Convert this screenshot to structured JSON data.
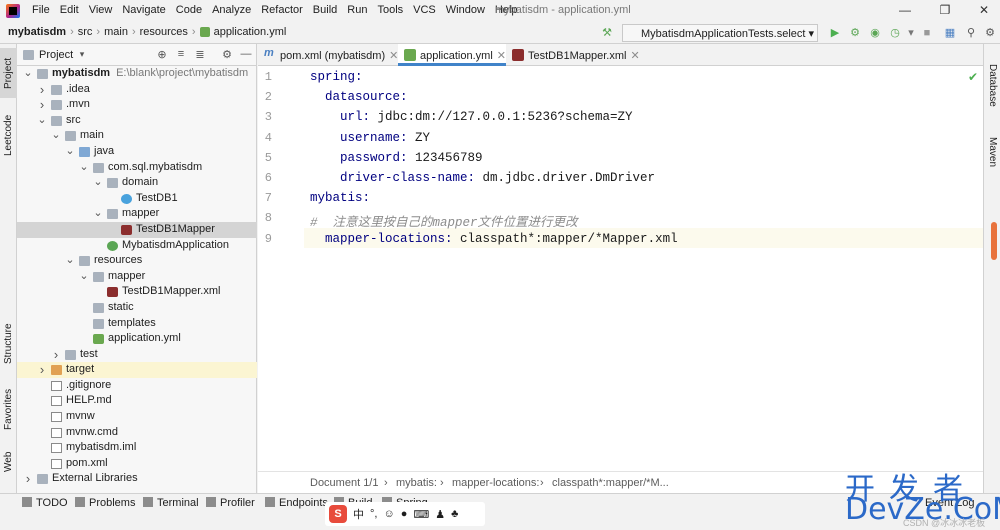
{
  "app": {
    "menus": [
      "File",
      "Edit",
      "View",
      "Navigate",
      "Code",
      "Analyze",
      "Refactor",
      "Build",
      "Run",
      "Tools",
      "VCS",
      "Window",
      "Help"
    ],
    "window_title": "mybatisdm - application.yml"
  },
  "breadcrumb": [
    "mybatisdm",
    "src",
    "main",
    "resources",
    "application.yml"
  ],
  "run_config": "MybatisdmApplicationTests.select",
  "left_tabs": [
    "Project",
    "Leetcode",
    "Structure",
    "Favorites",
    "Web"
  ],
  "right_tabs": [
    "Database",
    "Maven"
  ],
  "project_panel": {
    "title": "Project"
  },
  "tree": [
    {
      "label": "mybatisdm",
      "path": "E:\\blank\\project\\mybatisdm",
      "depth": 0,
      "arrow": "v",
      "icon": "folder"
    },
    {
      "label": ".idea",
      "depth": 1,
      "arrow": ">",
      "icon": "folder"
    },
    {
      "label": ".mvn",
      "depth": 1,
      "arrow": ">",
      "icon": "folder"
    },
    {
      "label": "src",
      "depth": 1,
      "arrow": "v",
      "icon": "folder"
    },
    {
      "label": "main",
      "depth": 2,
      "arrow": "v",
      "icon": "folder"
    },
    {
      "label": "java",
      "depth": 3,
      "arrow": "v",
      "icon": "folder-blue"
    },
    {
      "label": "com.sql.mybatisdm",
      "depth": 4,
      "arrow": "v",
      "icon": "folder"
    },
    {
      "label": "domain",
      "depth": 5,
      "arrow": "v",
      "icon": "folder"
    },
    {
      "label": "TestDB1",
      "depth": 6,
      "arrow": "",
      "icon": "class"
    },
    {
      "label": "mapper",
      "depth": 5,
      "arrow": "v",
      "icon": "folder"
    },
    {
      "label": "TestDB1Mapper",
      "depth": 6,
      "arrow": "",
      "icon": "xml",
      "selected": true
    },
    {
      "label": "MybatisdmApplication",
      "depth": 5,
      "arrow": "",
      "icon": "app"
    },
    {
      "label": "resources",
      "depth": 3,
      "arrow": "v",
      "icon": "folder"
    },
    {
      "label": "mapper",
      "depth": 4,
      "arrow": "v",
      "icon": "folder"
    },
    {
      "label": "TestDB1Mapper.xml",
      "depth": 5,
      "arrow": "",
      "icon": "xml"
    },
    {
      "label": "static",
      "depth": 4,
      "arrow": "",
      "icon": "folder"
    },
    {
      "label": "templates",
      "depth": 4,
      "arrow": "",
      "icon": "folder"
    },
    {
      "label": "application.yml",
      "depth": 4,
      "arrow": "",
      "icon": "yml"
    },
    {
      "label": "test",
      "depth": 2,
      "arrow": ">",
      "icon": "folder"
    },
    {
      "label": "target",
      "depth": 1,
      "arrow": ">",
      "icon": "folder-orange",
      "highlight": true
    },
    {
      "label": ".gitignore",
      "depth": 1,
      "arrow": "",
      "icon": "file"
    },
    {
      "label": "HELP.md",
      "depth": 1,
      "arrow": "",
      "icon": "file"
    },
    {
      "label": "mvnw",
      "depth": 1,
      "arrow": "",
      "icon": "file"
    },
    {
      "label": "mvnw.cmd",
      "depth": 1,
      "arrow": "",
      "icon": "file"
    },
    {
      "label": "mybatisdm.iml",
      "depth": 1,
      "arrow": "",
      "icon": "file"
    },
    {
      "label": "pom.xml",
      "depth": 1,
      "arrow": "",
      "icon": "file"
    },
    {
      "label": "External Libraries",
      "depth": 0,
      "arrow": ">",
      "icon": "folder"
    }
  ],
  "editor_tabs": [
    {
      "label": "pom.xml (mybatisdm)",
      "active": false
    },
    {
      "label": "application.yml",
      "active": true
    },
    {
      "label": "TestDB1Mapper.xml",
      "active": false
    }
  ],
  "code_lines": [
    {
      "n": "1",
      "key": "spring:",
      "val": ""
    },
    {
      "n": "2",
      "key": "  datasource:",
      "val": ""
    },
    {
      "n": "3",
      "key": "    url:",
      "val": " jdbc:dm://127.0.0.1:5236?schema=ZY"
    },
    {
      "n": "4",
      "key": "    username:",
      "val": " ZY"
    },
    {
      "n": "5",
      "key": "    password:",
      "val": " 123456789"
    },
    {
      "n": "6",
      "key": "    driver-class-name:",
      "val": " dm.jdbc.driver.DmDriver"
    },
    {
      "n": "7",
      "key": "mybatis:",
      "val": ""
    },
    {
      "n": "8",
      "key": "",
      "val": "#  注意这里按自己的mapper文件位置进行更改",
      "comment": true
    },
    {
      "n": "9",
      "key": "  mapper-locations:",
      "val": " classpath*:mapper/*Mapper.xml"
    }
  ],
  "status_crumbs": [
    "Document 1/1",
    "mybatis:",
    "mapper-locations:",
    "classpath*:mapper/*M..."
  ],
  "bottom_tools": [
    "TODO",
    "Problems",
    "Terminal",
    "Profiler",
    "Endpoints",
    "Build",
    "Spring",
    "Event Log"
  ],
  "watermark": {
    "line1": "开发者",
    "line2": "DevZe.CoM",
    "line3": "CSDN @冰冰冰老板"
  },
  "ime_label": "中"
}
